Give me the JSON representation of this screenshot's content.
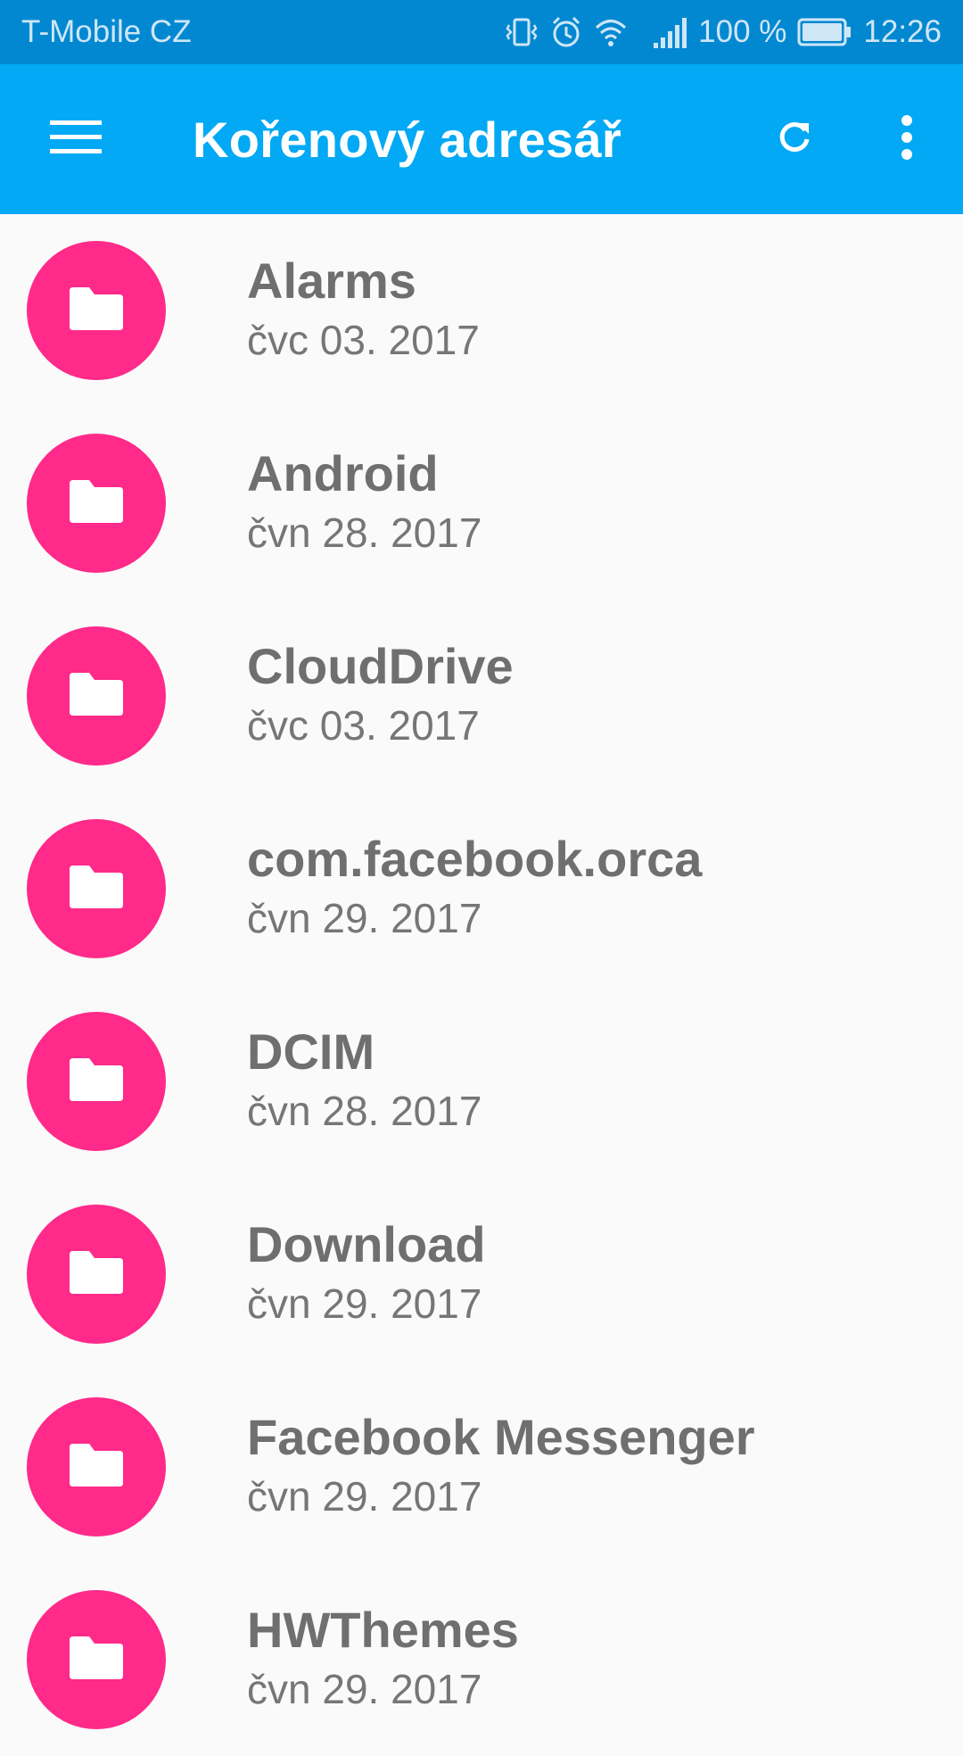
{
  "status_bar": {
    "carrier": "T-Mobile CZ",
    "battery": "100 %",
    "time": "12:26",
    "icons": [
      "vibrate-icon",
      "alarm-icon",
      "wifi-icon",
      "signal-icon",
      "battery-icon"
    ]
  },
  "toolbar": {
    "title": "Kořenový adresář",
    "menu_icon": "hamburger-menu-icon",
    "refresh_icon": "refresh-icon",
    "overflow_icon": "more-vert-icon"
  },
  "colors": {
    "status_bar": "#0288d1",
    "toolbar": "#03a9f4",
    "folder_avatar": "#ff2a8a",
    "background": "#fafafa"
  },
  "files": [
    {
      "name": "Alarms",
      "date": "čvc 03. 2017",
      "icon": "folder-icon"
    },
    {
      "name": "Android",
      "date": "čvn 28. 2017",
      "icon": "folder-icon"
    },
    {
      "name": "CloudDrive",
      "date": "čvc 03. 2017",
      "icon": "folder-icon"
    },
    {
      "name": "com.facebook.orca",
      "date": "čvn 29. 2017",
      "icon": "folder-icon"
    },
    {
      "name": "DCIM",
      "date": "čvn 28. 2017",
      "icon": "folder-icon"
    },
    {
      "name": "Download",
      "date": "čvn 29. 2017",
      "icon": "folder-icon"
    },
    {
      "name": "Facebook Messenger",
      "date": "čvn 29. 2017",
      "icon": "folder-icon"
    },
    {
      "name": "HWThemes",
      "date": "čvn 29. 2017",
      "icon": "folder-icon"
    }
  ]
}
